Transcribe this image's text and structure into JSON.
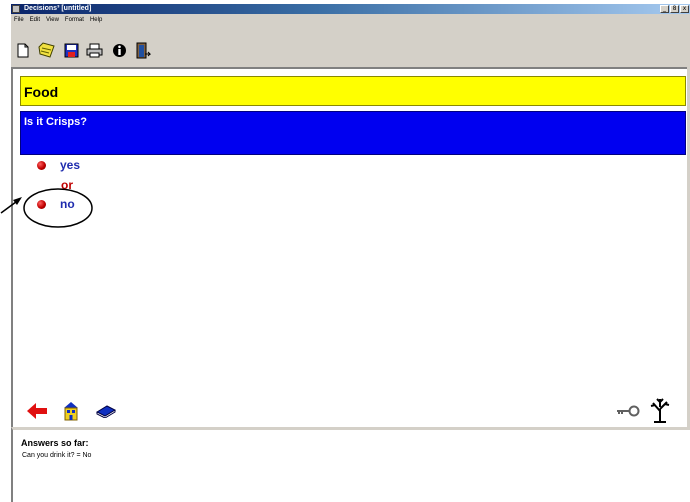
{
  "window": {
    "title": "Decisions³ [untitled]",
    "controls": [
      "_",
      "8",
      "x"
    ]
  },
  "menu": {
    "items": [
      "File",
      "Edit",
      "View",
      "Format",
      "Help"
    ]
  },
  "toolbar": {
    "buttons": [
      {
        "name": "new-icon",
        "color": "#ffffff"
      },
      {
        "name": "open-icon",
        "color": "#f0e040"
      },
      {
        "name": "save-icon",
        "color": "#2030c0"
      },
      {
        "name": "print-icon",
        "color": "#808080"
      },
      {
        "name": "info-icon",
        "color": "#000000"
      },
      {
        "name": "exit-icon",
        "color": "#2050a0"
      }
    ]
  },
  "decision": {
    "topic": "Food",
    "question": "Is it Crisps?",
    "answer_yes": "yes",
    "or_label": "or",
    "answer_no": "no"
  },
  "colors": {
    "topic_bg": "#ffff00",
    "question_bg": "#0000f0",
    "answer_text": "#1f2cae",
    "or_text": "#c00000"
  },
  "bottom_icons": {
    "left": [
      "back-arrow-icon",
      "house-icon",
      "book-icon"
    ],
    "right": [
      "key-icon",
      "tree-icon"
    ]
  },
  "answers_panel": {
    "title": "Answers so far:",
    "entries": [
      "Can you drink it? = No"
    ]
  }
}
